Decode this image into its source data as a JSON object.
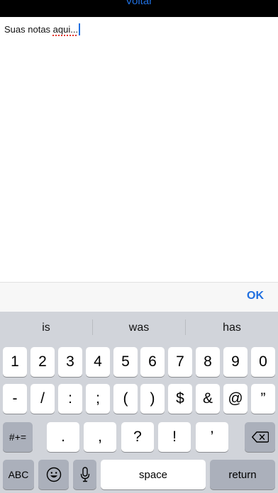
{
  "nav": {
    "back_label": "Voltar"
  },
  "editor": {
    "text_plain": "Suas notas ",
    "text_misspelled": "aqui...",
    "placeholder": "Suas notas aqui..."
  },
  "accessory": {
    "ok_label": "OK"
  },
  "keyboard": {
    "suggestions": [
      "is",
      "was",
      "has"
    ],
    "row1": [
      "1",
      "2",
      "3",
      "4",
      "5",
      "6",
      "7",
      "8",
      "9",
      "0"
    ],
    "row2": [
      "-",
      "/",
      ":",
      ";",
      "(",
      ")",
      "$",
      "&",
      "@",
      "”"
    ],
    "row3_shift": "#+=",
    "row3": [
      ".",
      ",",
      "?",
      "!",
      "’"
    ],
    "abc_label": "ABC",
    "space_label": "space",
    "return_label": "return",
    "icons": [
      "backspace-icon",
      "emoji-icon",
      "microphone-icon"
    ]
  },
  "colors": {
    "accent": "#1f6fe0",
    "keyboard_bg": "#d1d4da",
    "function_key": "#abb0bb"
  }
}
